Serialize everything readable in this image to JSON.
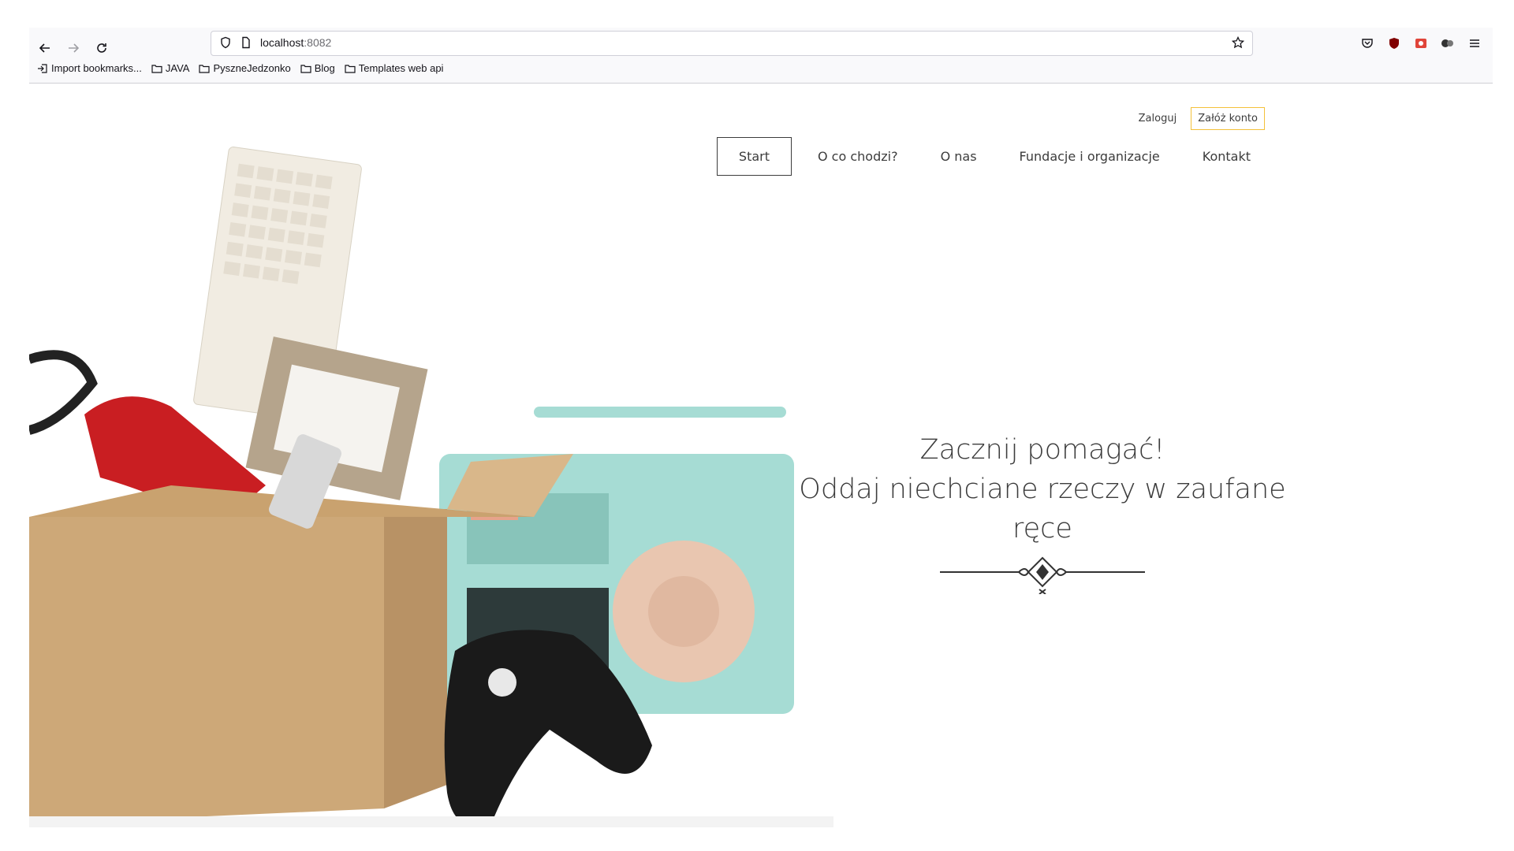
{
  "browser": {
    "url_host": "localhost",
    "url_port": ":8082",
    "bookmarks": [
      {
        "label": "Import bookmarks..."
      },
      {
        "label": "JAVA"
      },
      {
        "label": "PyszneJedzonko"
      },
      {
        "label": "Blog"
      },
      {
        "label": "Templates web api"
      }
    ]
  },
  "header": {
    "login_label": "Zaloguj",
    "register_label": "Załóż konto",
    "nav": [
      {
        "label": "Start",
        "active": true
      },
      {
        "label": "O co chodzi?"
      },
      {
        "label": "O nas"
      },
      {
        "label": "Fundacje i organizacje"
      },
      {
        "label": "Kontakt"
      }
    ]
  },
  "hero": {
    "line1": "Zacznij pomagać!",
    "line2": "Oddaj niechciane rzeczy w zaufane ręce"
  },
  "colors": {
    "accent": "#f3c13a",
    "text": "#3c3c3c"
  }
}
